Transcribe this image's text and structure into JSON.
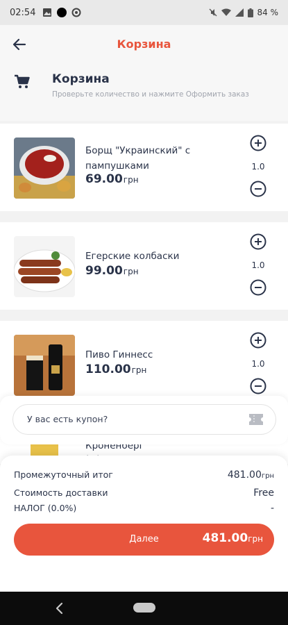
{
  "status_bar": {
    "time": "02:54",
    "battery": "84 %"
  },
  "app_bar": {
    "title": "Корзина",
    "back_icon": "arrow-left-icon"
  },
  "header": {
    "title": "Корзина",
    "subtitle": "Проверьте количество и нажмите Оформить заказ",
    "icon": "cart-icon"
  },
  "items": [
    {
      "name": "Борщ \"Украинский\" с пампушками",
      "price": "69.00",
      "currency": "грн",
      "qty": "1.0"
    },
    {
      "name": "Егерские колбаски",
      "price": "99.00",
      "currency": "грн",
      "qty": "1.0"
    },
    {
      "name": "Пиво Гиннесс",
      "price": "110.00",
      "currency": "грн",
      "qty": "1.0"
    },
    {
      "name": "Кроненберг",
      "subtitle": "(…)"
    }
  ],
  "coupon": {
    "placeholder": "У вас есть купон?",
    "icon": "ticket-icon"
  },
  "summary": {
    "subtotal_label": "Промежуточный итог",
    "subtotal_value": "481.00",
    "delivery_label": "Стоимость доставки",
    "delivery_value": "Free",
    "tax_label": "НАЛОГ (0.0%)",
    "tax_value": "-",
    "currency": "грн"
  },
  "checkout": {
    "label": "Далее",
    "amount": "481.00",
    "currency": "грн"
  },
  "colors": {
    "accent": "#e8553d",
    "text": "#2a3349"
  }
}
